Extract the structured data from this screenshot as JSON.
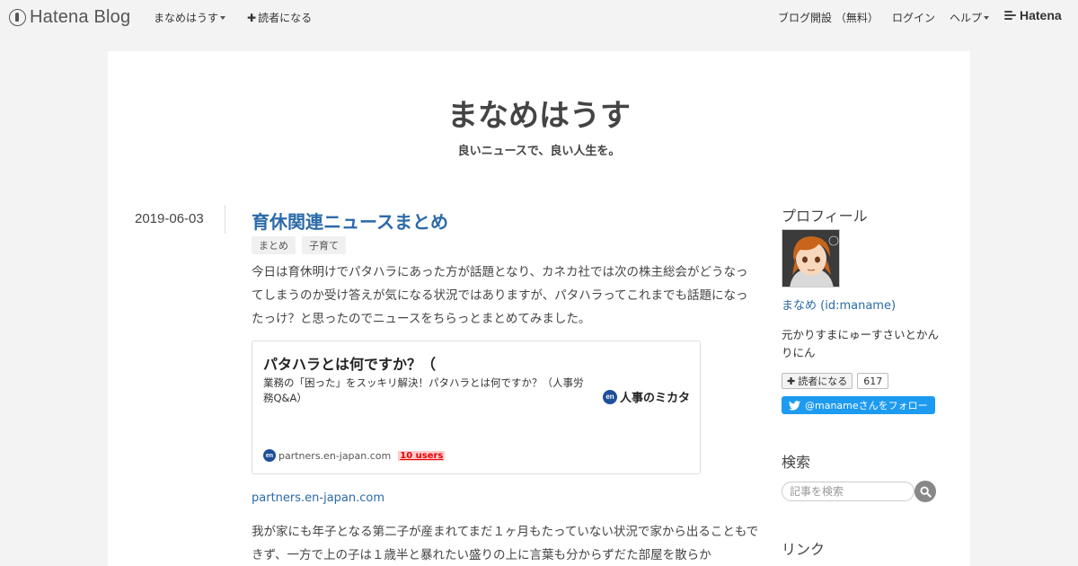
{
  "global_header": {
    "logo": "Hatena Blog",
    "blog_menu": "まなめはうす",
    "subscribe": "読者になる",
    "signup": "ブログ開設 （無料）",
    "login": "ログイン",
    "help": "ヘルプ",
    "hatena": "Hatena"
  },
  "blog": {
    "title": "まなめはうす",
    "description": "良いニュースで、良い人生を。"
  },
  "entry": {
    "date": "2019-06-03",
    "title": "育休関連ニュースまとめ",
    "categories": [
      "まとめ",
      "子育て"
    ],
    "paragraph1": "今日は育休明けでパタハラにあった方が話題となり、カネカ社では次の株主総会がどうなってしまうのか受け答えが気になる状況ではありますが、パタハラってこれまでも話題になったっけ？と思ったのでニュースをちらっとまとめてみました。",
    "card": {
      "title": "パタハラとは何ですか？（",
      "description": "業務の「困った」をスッキリ解決！パタハラとは何ですか？（人事労務Q&A）",
      "brand_badge": "en",
      "brand": "人事のミカタ",
      "domain": "partners.en-japan.com",
      "users": "10 users"
    },
    "link": "partners.en-japan.com",
    "paragraph2": "我が家にも年子となる第二子が産まれてまだ１ヶ月もたっていない状況で家から出ることもできず、一方で上の子は１歳半と暴れたい盛りの上に言葉も分からずだた部屋を散らか"
  },
  "sidebar": {
    "profile_heading": "プロフィール",
    "profile_name": "まなめ (id:maname)",
    "profile_desc": "元かりすまにゅーすさいとかんりにん",
    "subscribe_label": "読者になる",
    "subscribe_count": "617",
    "follow_label": "@manameさんをフォロー",
    "search_heading": "検索",
    "search_placeholder": "記事を検索",
    "links_heading": "リンク"
  },
  "colors": {
    "link": "#2b6aa8",
    "twitter": "#1d9bf0",
    "users_red": "#e60000"
  }
}
